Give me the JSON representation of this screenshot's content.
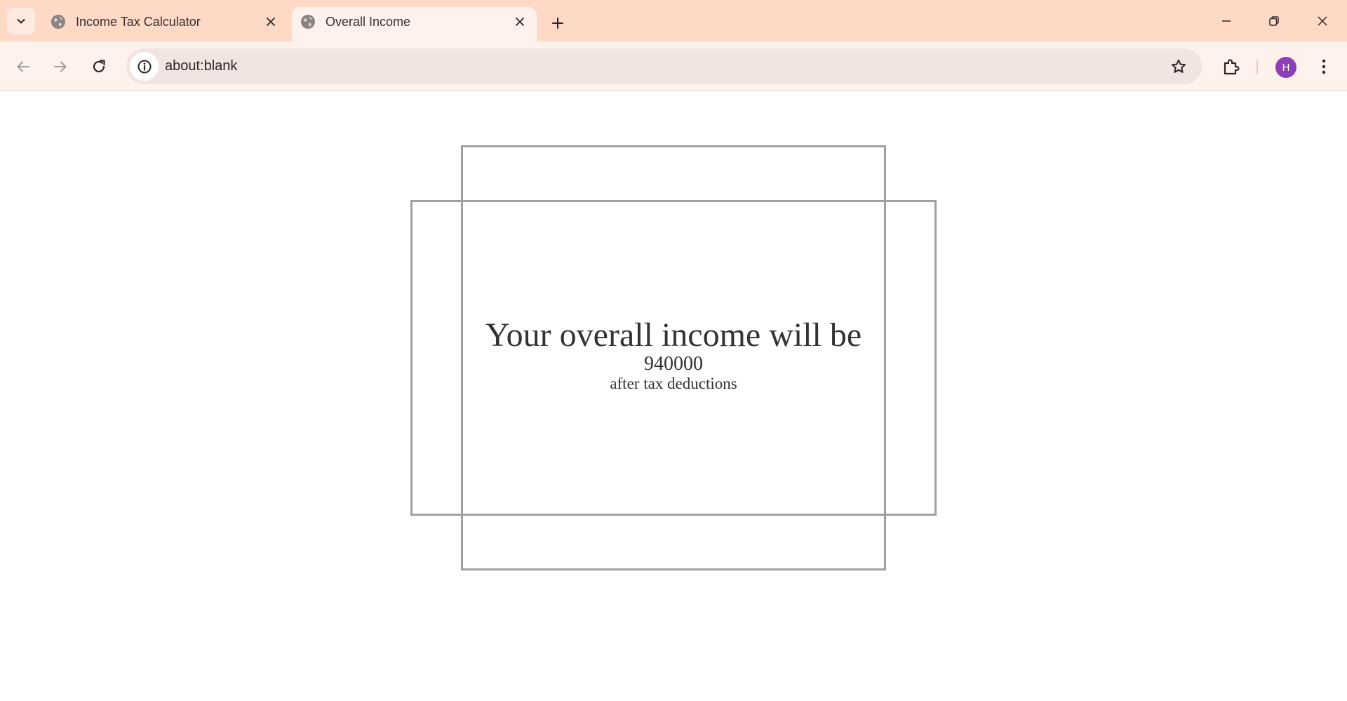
{
  "browser": {
    "tabs": [
      {
        "title": "Income Tax Calculator",
        "active": false,
        "favicon": "globe-icon"
      },
      {
        "title": "Overall Income",
        "active": true,
        "favicon": "globe-icon"
      }
    ],
    "address_bar": {
      "url": "about:blank"
    },
    "profile_initial": "H",
    "colors": {
      "tab_strip": "#fdd9c6",
      "toolbar": "#fff1ec",
      "omnibox": "#f2e4e0",
      "avatar": "#8e3fb5"
    }
  },
  "page": {
    "headline": "Your overall income will be",
    "amount": "940000",
    "note": "after tax deductions",
    "colors": {
      "text": "#333333",
      "frame_border": "#a0a0a0"
    }
  }
}
